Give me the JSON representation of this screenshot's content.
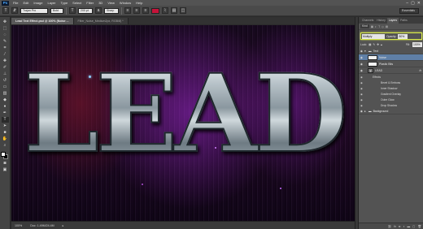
{
  "app": {
    "logo": "Ps"
  },
  "menu": [
    "File",
    "Edit",
    "Image",
    "Layer",
    "Type",
    "Select",
    "Filter",
    "3D",
    "View",
    "Window",
    "Help"
  ],
  "window_controls": [
    "–",
    "▢",
    "✕"
  ],
  "options_bar": {
    "font_family": "Trajan Pro",
    "font_style": "Bold",
    "font_size": "200 pt",
    "antialias": "Sharp",
    "text_color": "#c5133a",
    "workspace": "Essentials"
  },
  "document_tabs": [
    {
      "label": "Lead Text Effect.psd @ 100% (Noise ...",
      "active": true
    },
    {
      "label": "Filter_Noise_Medium2px, RGB/8) *",
      "active": false
    }
  ],
  "canvas": {
    "text": "LEAD"
  },
  "status": {
    "zoom": "100%",
    "doc": "Doc: 1.49M/24.4M"
  },
  "panel": {
    "tabs": [
      "Channels",
      "History",
      "Layers",
      "Paths"
    ],
    "active_tab": "Layers",
    "filter_kind": "Kind",
    "blend_mode": "Multiply",
    "opacity_label": "Opacity:",
    "opacity": "80%",
    "lock_label": "Lock:",
    "fill_label": "Fill:",
    "fill": "100%",
    "layers": [
      {
        "name": "Text",
        "type": "group"
      },
      {
        "name": "Noise",
        "type": "layer",
        "selected": true
      },
      {
        "name": "Plastic Bits",
        "type": "layer"
      },
      {
        "name": "LEAD",
        "type": "text",
        "fx": "fx"
      },
      {
        "name": "Effects",
        "type": "effects"
      }
    ],
    "effects": [
      "Bevel & Emboss",
      "Inner Shadow",
      "Gradient Overlay",
      "Outer Glow",
      "Drop Shadow"
    ],
    "background_group": "Background"
  }
}
